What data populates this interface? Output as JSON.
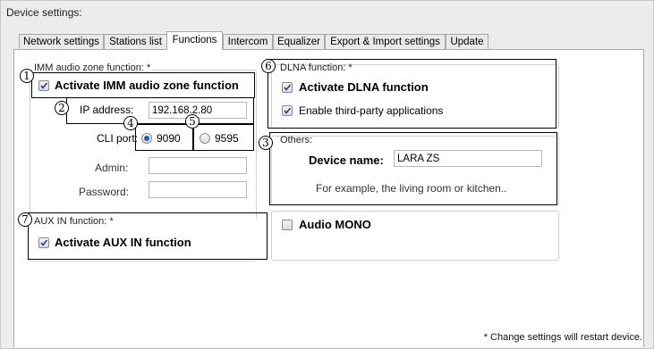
{
  "window": {
    "title": "Device settings:"
  },
  "tabs": [
    {
      "label": "Network settings"
    },
    {
      "label": "Stations list"
    },
    {
      "label": "Functions"
    },
    {
      "label": "Intercom"
    },
    {
      "label": "Equalizer"
    },
    {
      "label": "Export & Import settings"
    },
    {
      "label": "Update"
    }
  ],
  "active_tab": "Functions",
  "imm": {
    "legend": "IMM audio zone function: *",
    "activate_label": "Activate IMM audio zone function",
    "activate_checked": true,
    "ip_label": "IP address:",
    "ip_value": "192.168.2.80",
    "cli_port_label": "CLI port:",
    "port_options": [
      "9090",
      "9595"
    ],
    "port_selected": "9090",
    "admin_label": "Admin:",
    "admin_value": "",
    "password_label": "Password:",
    "password_value": ""
  },
  "aux": {
    "legend": "AUX IN function: *",
    "activate_label": "Activate AUX IN function",
    "activate_checked": true
  },
  "dlna": {
    "legend": "DLNA function: *",
    "activate_label": "Activate DLNA function",
    "activate_checked": true,
    "third_party_label": "Enable third-party applications",
    "third_party_checked": true
  },
  "others": {
    "legend": "Others:",
    "device_name_label": "Device name:",
    "device_name_value": "LARA ZS",
    "hint": "For example, the living room or kitchen.."
  },
  "audio_mono": {
    "label": "Audio MONO",
    "checked": false
  },
  "footnote": "* Change settings will restart device.",
  "callouts": [
    "1",
    "2",
    "3",
    "4",
    "5",
    "6",
    "7"
  ]
}
